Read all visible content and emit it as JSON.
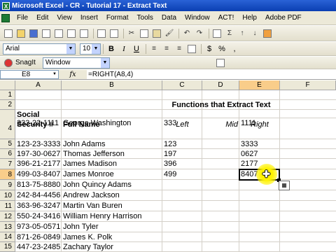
{
  "window": {
    "title": "Microsoft Excel - CR - Tutorial 17 - Extract Text"
  },
  "menu": [
    "File",
    "Edit",
    "View",
    "Insert",
    "Format",
    "Tools",
    "Data",
    "Window",
    "ACT!",
    "Help",
    "Adobe PDF"
  ],
  "toolbar": {
    "font_name": "Arial",
    "font_size": "10",
    "bold": "B",
    "italic": "I",
    "underline": "U",
    "currency": "$",
    "percent": "%",
    "comma": ",",
    "snagit_label": "SnagIt",
    "snagit_target": "Window",
    "sum": "Σ"
  },
  "formula_bar": {
    "name_box": "E8",
    "fx": "fx",
    "formula": "=RIGHT(A8,4)"
  },
  "columns": [
    "A",
    "B",
    "C",
    "D",
    "E",
    "F"
  ],
  "rows": [
    "1",
    "2",
    "3",
    "4",
    "5",
    "6",
    "7",
    "8",
    "9",
    "10",
    "11",
    "12",
    "13",
    "14",
    "15"
  ],
  "sheet": {
    "header_title": "Functions that Extract Text",
    "col_a_header_line1": "Social",
    "col_a_header_line2": "Security #",
    "col_b_header": "Full Name",
    "left": "Left",
    "mid": "Mid",
    "right": "Right",
    "data": [
      {
        "ssn": "333-22-1111",
        "name": "George Washington",
        "left": "333",
        "right": "1111"
      },
      {
        "ssn": "123-23-3333",
        "name": "John Adams",
        "left": "123",
        "right": "3333"
      },
      {
        "ssn": "197-30-0627",
        "name": "Thomas Jefferson",
        "left": "197",
        "right": "0627"
      },
      {
        "ssn": "396-21-2177",
        "name": "James Madison",
        "left": "396",
        "right": "2177"
      },
      {
        "ssn": "499-03-8407",
        "name": "James Monroe",
        "left": "499",
        "right": "8407"
      },
      {
        "ssn": "813-75-8880",
        "name": "John Quincy Adams",
        "left": "",
        "right": ""
      },
      {
        "ssn": "242-84-4456",
        "name": "Andrew Jackson",
        "left": "",
        "right": ""
      },
      {
        "ssn": "363-96-3247",
        "name": "Martin Van Buren",
        "left": "",
        "right": ""
      },
      {
        "ssn": "550-24-3416",
        "name": "William Henry Harrison",
        "left": "",
        "right": ""
      },
      {
        "ssn": "973-05-0571",
        "name": "John Tyler",
        "left": "",
        "right": ""
      },
      {
        "ssn": "871-26-0849",
        "name": "James K. Polk",
        "left": "",
        "right": ""
      },
      {
        "ssn": "447-23-2485",
        "name": "Zachary Taylor",
        "left": "",
        "right": ""
      }
    ]
  },
  "active_cell": "E8",
  "colors": {
    "selection_header": "#f9cd8a",
    "cursor_highlight": "#fff200",
    "title_bar": "#0a3fb2"
  }
}
